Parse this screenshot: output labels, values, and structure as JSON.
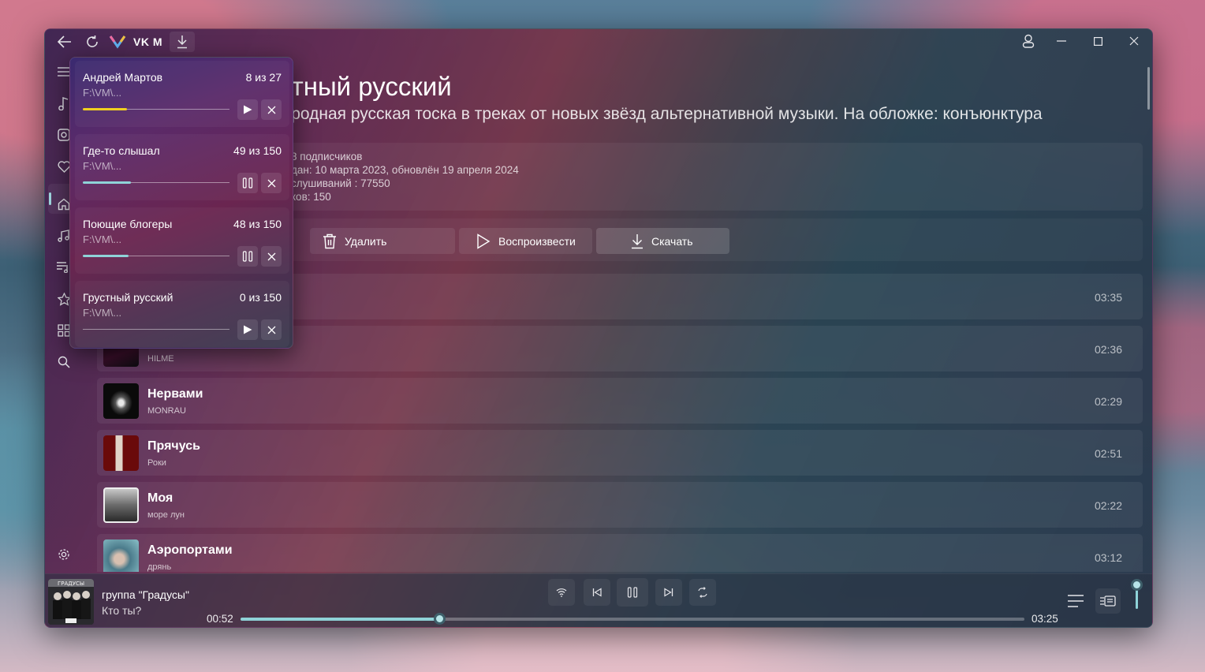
{
  "app": {
    "title": "VK M"
  },
  "playlist": {
    "title": "Грустный русский",
    "title_visible": "рустный русский",
    "description": "акая родная русская тоска в треках от новых звёзд альтернативной музыки. На обложке: конъюнктура",
    "info": [
      "8 подписчиков",
      "дан: 10 марта 2023, обновлён 19 апреля 2024",
      "слушиваний : 77550",
      "ков: 150"
    ],
    "actions": {
      "delete": "Удалить",
      "play": "Воспроизвести",
      "download": "Скачать"
    }
  },
  "tracks": [
    {
      "title": "",
      "artist": "",
      "duration": "03:35"
    },
    {
      "title": "",
      "artist": "HILME",
      "duration": "02:36"
    },
    {
      "title": "Нервами",
      "artist": "MONRAU",
      "duration": "02:29"
    },
    {
      "title": "Прячусь",
      "artist": "Роки",
      "duration": "02:51"
    },
    {
      "title": "Моя",
      "artist": "море лун",
      "duration": "02:22"
    },
    {
      "title": "Аэропортами",
      "artist": "дрянь",
      "duration": "03:12"
    }
  ],
  "downloads": [
    {
      "name": "Андрей Мартов",
      "count": "8 из 27",
      "path": "F:\\VM\\...",
      "progress": 0.3,
      "state": "paused",
      "color": "#f0d020"
    },
    {
      "name": "Где-то слышал",
      "count": "49 из 150",
      "path": "F:\\VM\\...",
      "progress": 0.33,
      "state": "downloading",
      "color": "#8fd3d8"
    },
    {
      "name": "Поющие блогеры",
      "count": "48 из 150",
      "path": "F:\\VM\\...",
      "progress": 0.31,
      "state": "downloading",
      "color": "#8fd3d8"
    },
    {
      "name": "Грустный русский",
      "count": "0 из 150",
      "path": "F:\\VM\\...",
      "progress": 0,
      "state": "paused",
      "color": "#8fd3d8"
    }
  ],
  "player": {
    "title": "группа \"Градусы\"",
    "artist": "Кто ты?",
    "elapsed": "00:52",
    "total": "03:25",
    "progress": 0.254,
    "volume": 1.0,
    "cover_text": "ГРАДУСЫ"
  },
  "colors": {
    "accent": "#8fd3d8",
    "download_highlight": "#f0d020"
  }
}
